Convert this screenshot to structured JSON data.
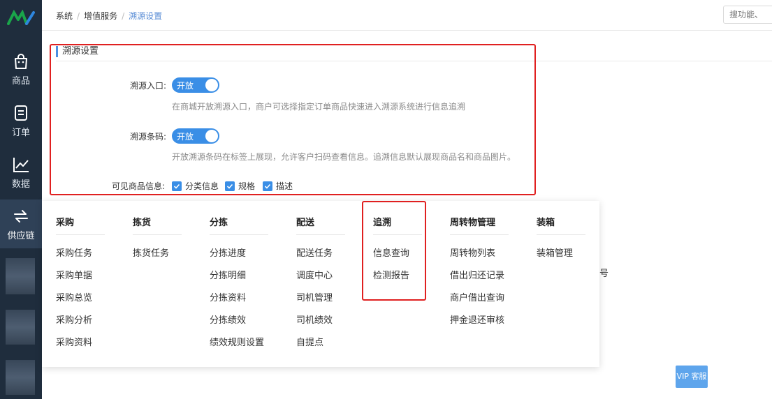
{
  "sidebar": {
    "logo_alt": "AV",
    "items": [
      {
        "label": "商品",
        "icon": "shopping-bag-icon"
      },
      {
        "label": "订单",
        "icon": "order-doc-icon"
      },
      {
        "label": "数据",
        "icon": "line-chart-icon"
      },
      {
        "label": "供应链",
        "icon": "exchange-arrows-icon"
      }
    ]
  },
  "breadcrumb": {
    "items": [
      "系统",
      "增值服务",
      "溯源设置"
    ]
  },
  "search": {
    "placeholder": "搜功能、"
  },
  "settings": {
    "title": "溯源设置",
    "entry_label": "溯源入口:",
    "entry_toggle": "开放",
    "entry_hint": "在商城开放溯源入口，商户可选择指定订单商品快速进入溯源系统进行信息追溯",
    "barcode_label": "溯源条码:",
    "barcode_toggle": "开放",
    "barcode_hint": "开放溯源条码在标签上展现，允许客户扫码查看信息。追溯信息默认展现商品名和商品图片。",
    "visible_label": "可见商品信息:",
    "checks": [
      "分类信息",
      "规格",
      "描述"
    ]
  },
  "menu": {
    "columns": [
      {
        "head": "采购",
        "items": [
          "采购任务",
          "采购单据",
          "采购总览",
          "采购分析",
          "采购资料"
        ]
      },
      {
        "head": "拣货",
        "items": [
          "拣货任务"
        ]
      },
      {
        "head": "分拣",
        "items": [
          "分拣进度",
          "分拣明细",
          "分拣资料",
          "分拣绩效",
          "绩效规则设置"
        ]
      },
      {
        "head": "配送",
        "items": [
          "配送任务",
          "调度中心",
          "司机管理",
          "司机绩效",
          "自提点"
        ]
      },
      {
        "head": "追溯",
        "items": [
          "信息查询",
          "检测报告"
        ]
      },
      {
        "head": "周转物管理",
        "items": [
          "周转物列表",
          "借出归还记录",
          "商户借出查询",
          "押金退还审核"
        ]
      },
      {
        "head": "装箱",
        "items": [
          "装箱管理"
        ]
      }
    ]
  },
  "float_button": "VIP 客服",
  "stray_text": "号",
  "colors": {
    "accent": "#3a8ee6",
    "sidebar": "#1f2d3d",
    "highlight": "#e02020"
  }
}
